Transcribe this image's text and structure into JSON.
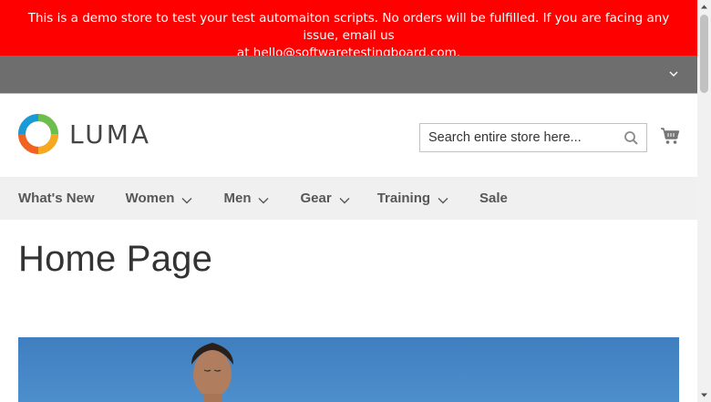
{
  "demo_notice": {
    "line1": "This is a demo store to test your test automaiton scripts. No orders will be fulfilled. If you are facing any issue, email us",
    "line2": "at hello@softwaretestingboard.com."
  },
  "header": {
    "logo_text": "LUMA",
    "search": {
      "placeholder": "Search entire store here..."
    },
    "cart_icon": "cart-icon"
  },
  "nav": {
    "items": [
      {
        "label": "What's New",
        "has_submenu": false
      },
      {
        "label": "Women",
        "has_submenu": true
      },
      {
        "label": "Men",
        "has_submenu": true
      },
      {
        "label": "Gear",
        "has_submenu": true
      },
      {
        "label": "Training",
        "has_submenu": true
      },
      {
        "label": "Sale",
        "has_submenu": false
      }
    ]
  },
  "main": {
    "page_title": "Home Page"
  },
  "colors": {
    "notice_bg": "#ff0000",
    "panel_header_bg": "#6e6e6e",
    "nav_bg": "#f0f0f0",
    "nav_text": "#575757",
    "hero_sky": "#4a89c8"
  }
}
